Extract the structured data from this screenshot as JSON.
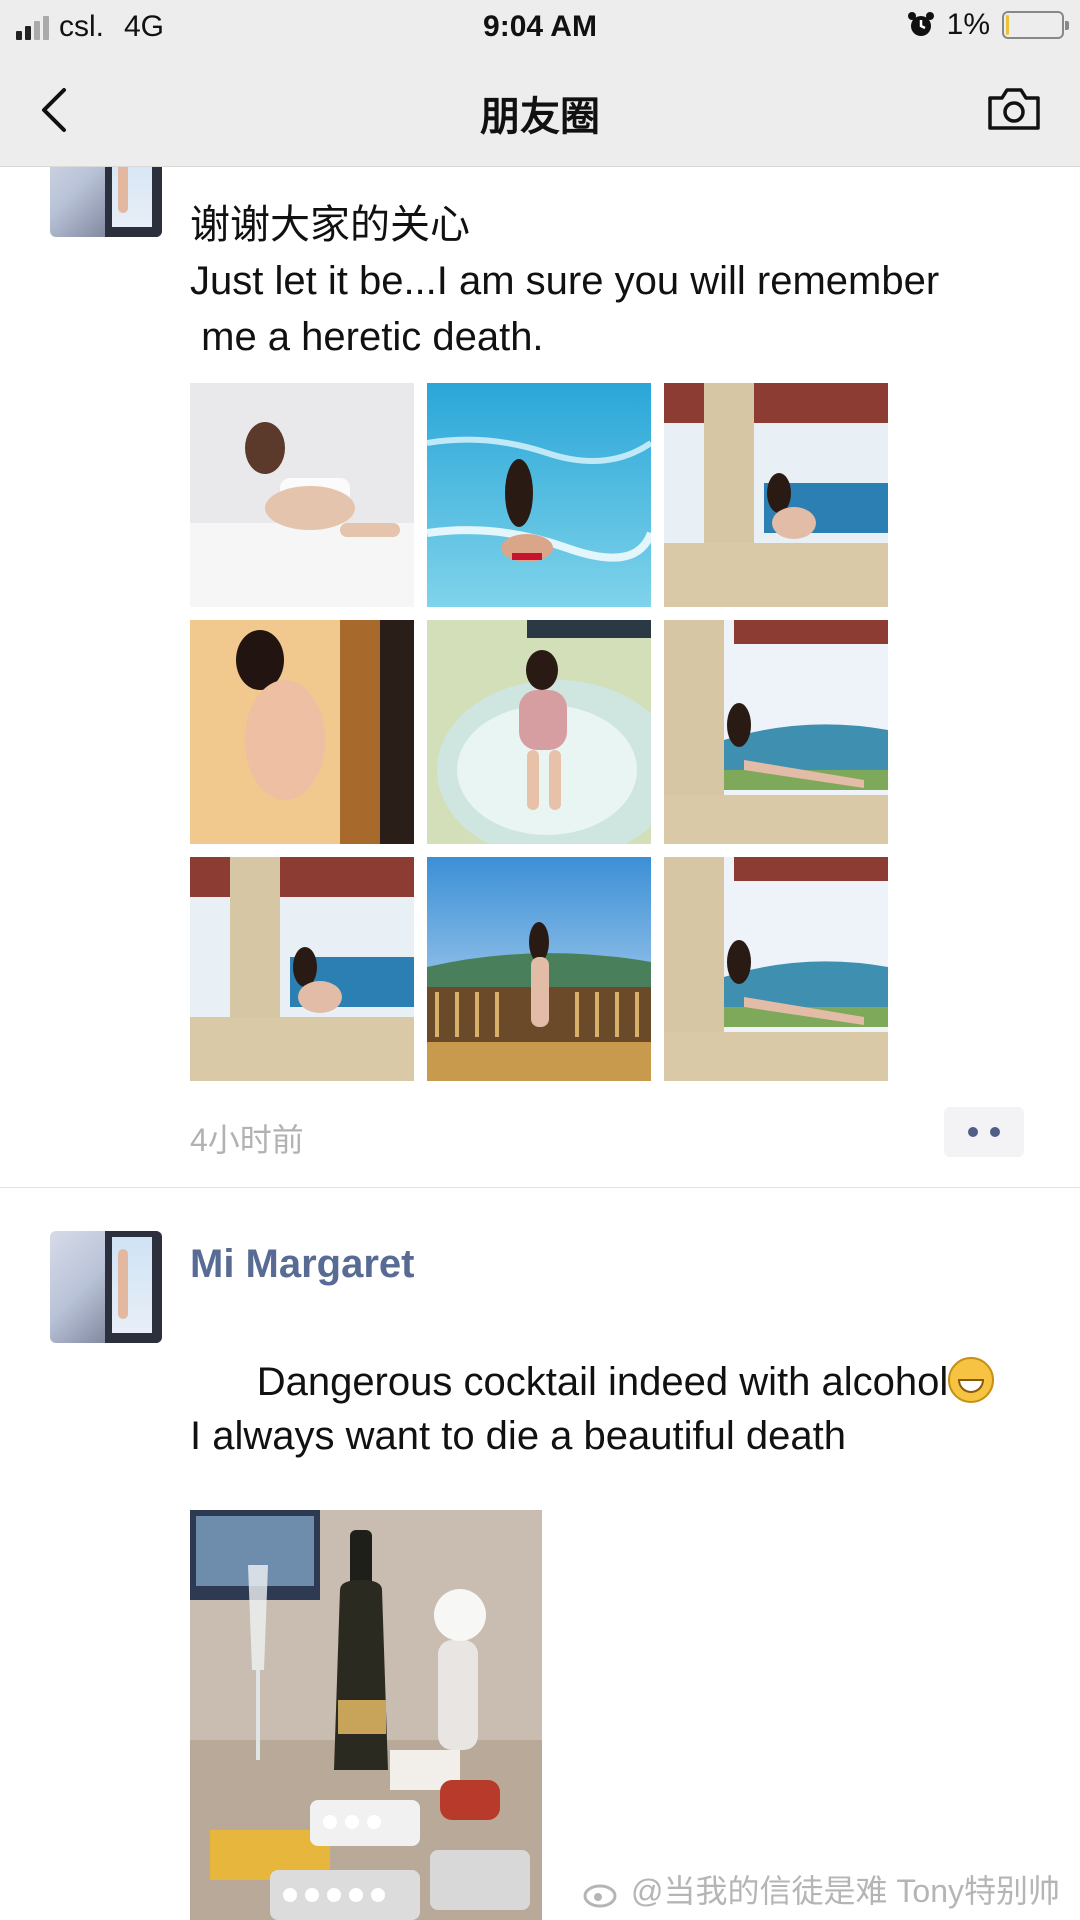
{
  "status_bar": {
    "carrier": "csl.",
    "network": "4G",
    "time": "9:04 AM",
    "battery": "1%",
    "battery_level": 0.01,
    "icons": [
      "signal-icon",
      "alarm-icon",
      "battery-icon"
    ]
  },
  "nav": {
    "title": "朋友圈",
    "back_icon": "chevron-left-icon",
    "camera_icon": "camera-icon"
  },
  "posts": [
    {
      "text_line1": "谢谢大家的关心",
      "text_line2": "Just let it be...I am sure you will remember",
      "text_line3": " me a heretic death.",
      "photos": [
        "bed-photo",
        "sea-photo",
        "balcony-bottle-photo",
        "door-photo",
        "bathtub-photo",
        "balcony-drinking-photo",
        "balcony-bottle-photo-2",
        "railing-photo",
        "balcony-drinking-photo-2"
      ],
      "timestamp": "4小时前",
      "more_icon": "more-dots-icon"
    },
    {
      "username": "Mi Margaret",
      "text_line1": "Dangerous cocktail indeed with alcohol",
      "text_line2": "I always want to die a beautiful death",
      "emoji": "grinning-face-emoji",
      "photo": "champagne-pills-photo"
    }
  ],
  "watermark": {
    "text": "@当我的信徒是难  Tony特别帅",
    "icon": "weibo-logo-icon"
  },
  "colors": {
    "bar_bg": "#ededed",
    "username": "#576b95",
    "timestamp": "#b2b2b2",
    "battery_fill": "#e8c23a"
  }
}
